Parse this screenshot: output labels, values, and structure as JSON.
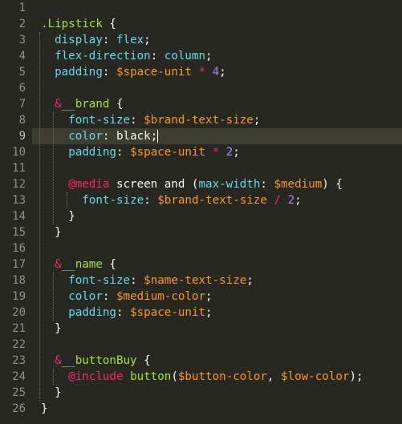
{
  "editor": {
    "theme_colors": {
      "background": "#272822",
      "line_highlight": "#3e3d32",
      "gutter_text": "#8f908a",
      "selector": "#a6e22e",
      "property": "#66d9ef",
      "variable": "#fd971f",
      "number": "#ae81ff",
      "at_rule": "#f92672",
      "text": "#f8f8f2"
    },
    "active_line": 9,
    "lines": [
      {
        "num": "1",
        "indent": 0,
        "tokens": []
      },
      {
        "num": "2",
        "indent": 0,
        "tokens": [
          {
            "t": "sel",
            "v": ".Lipstick"
          },
          {
            "t": "plain",
            "v": " {"
          }
        ]
      },
      {
        "num": "3",
        "indent": 1,
        "tokens": [
          {
            "t": "prop",
            "v": "display"
          },
          {
            "t": "plain",
            "v": ": "
          },
          {
            "t": "prop",
            "v": "flex"
          },
          {
            "t": "plain",
            "v": ";"
          }
        ]
      },
      {
        "num": "4",
        "indent": 1,
        "tokens": [
          {
            "t": "prop",
            "v": "flex-direction"
          },
          {
            "t": "plain",
            "v": ": "
          },
          {
            "t": "prop",
            "v": "column"
          },
          {
            "t": "plain",
            "v": ";"
          }
        ]
      },
      {
        "num": "5",
        "indent": 1,
        "tokens": [
          {
            "t": "prop",
            "v": "padding"
          },
          {
            "t": "plain",
            "v": ": "
          },
          {
            "t": "var",
            "v": "$space-unit"
          },
          {
            "t": "plain",
            "v": " "
          },
          {
            "t": "at",
            "v": "*"
          },
          {
            "t": "plain",
            "v": " "
          },
          {
            "t": "num",
            "v": "4"
          },
          {
            "t": "plain",
            "v": ";"
          }
        ]
      },
      {
        "num": "6",
        "indent": 0,
        "tokens": []
      },
      {
        "num": "7",
        "indent": 1,
        "tokens": [
          {
            "t": "at",
            "v": "&"
          },
          {
            "t": "sel",
            "v": "__brand"
          },
          {
            "t": "plain",
            "v": " {"
          }
        ]
      },
      {
        "num": "8",
        "indent": 2,
        "tokens": [
          {
            "t": "prop",
            "v": "font-size"
          },
          {
            "t": "plain",
            "v": ": "
          },
          {
            "t": "var",
            "v": "$brand-text-size"
          },
          {
            "t": "plain",
            "v": ";"
          }
        ]
      },
      {
        "num": "9",
        "indent": 2,
        "tokens": [
          {
            "t": "prop",
            "v": "color"
          },
          {
            "t": "plain",
            "v": ": "
          },
          {
            "t": "plain",
            "v": "black"
          },
          {
            "t": "plain",
            "v": ";"
          },
          {
            "t": "cursor",
            "v": ""
          }
        ]
      },
      {
        "num": "10",
        "indent": 2,
        "tokens": [
          {
            "t": "prop",
            "v": "padding"
          },
          {
            "t": "plain",
            "v": ": "
          },
          {
            "t": "var",
            "v": "$space-unit"
          },
          {
            "t": "plain",
            "v": " "
          },
          {
            "t": "at",
            "v": "*"
          },
          {
            "t": "plain",
            "v": " "
          },
          {
            "t": "num",
            "v": "2"
          },
          {
            "t": "plain",
            "v": ";"
          }
        ]
      },
      {
        "num": "11",
        "indent": 0,
        "tokens": []
      },
      {
        "num": "12",
        "indent": 2,
        "tokens": [
          {
            "t": "at",
            "v": "@media"
          },
          {
            "t": "plain",
            "v": " screen and ("
          },
          {
            "t": "prop",
            "v": "max-width"
          },
          {
            "t": "plain",
            "v": ": "
          },
          {
            "t": "var",
            "v": "$medium"
          },
          {
            "t": "plain",
            "v": ") {"
          }
        ]
      },
      {
        "num": "13",
        "indent": 3,
        "tokens": [
          {
            "t": "prop",
            "v": "font-size"
          },
          {
            "t": "plain",
            "v": ": "
          },
          {
            "t": "var",
            "v": "$brand-text-size"
          },
          {
            "t": "plain",
            "v": " "
          },
          {
            "t": "at",
            "v": "/"
          },
          {
            "t": "plain",
            "v": " "
          },
          {
            "t": "num",
            "v": "2"
          },
          {
            "t": "plain",
            "v": ";"
          }
        ]
      },
      {
        "num": "14",
        "indent": 2,
        "tokens": [
          {
            "t": "plain",
            "v": "}"
          }
        ]
      },
      {
        "num": "15",
        "indent": 1,
        "tokens": [
          {
            "t": "plain",
            "v": "}"
          }
        ]
      },
      {
        "num": "16",
        "indent": 0,
        "tokens": []
      },
      {
        "num": "17",
        "indent": 1,
        "tokens": [
          {
            "t": "at",
            "v": "&"
          },
          {
            "t": "sel",
            "v": "__name"
          },
          {
            "t": "plain",
            "v": " {"
          }
        ]
      },
      {
        "num": "18",
        "indent": 2,
        "tokens": [
          {
            "t": "prop",
            "v": "font-size"
          },
          {
            "t": "plain",
            "v": ": "
          },
          {
            "t": "var",
            "v": "$name-text-size"
          },
          {
            "t": "plain",
            "v": ";"
          }
        ]
      },
      {
        "num": "19",
        "indent": 2,
        "tokens": [
          {
            "t": "prop",
            "v": "color"
          },
          {
            "t": "plain",
            "v": ": "
          },
          {
            "t": "var",
            "v": "$medium-color"
          },
          {
            "t": "plain",
            "v": ";"
          }
        ]
      },
      {
        "num": "20",
        "indent": 2,
        "tokens": [
          {
            "t": "prop",
            "v": "padding"
          },
          {
            "t": "plain",
            "v": ": "
          },
          {
            "t": "var",
            "v": "$space-unit"
          },
          {
            "t": "plain",
            "v": ";"
          }
        ]
      },
      {
        "num": "21",
        "indent": 1,
        "tokens": [
          {
            "t": "plain",
            "v": "}"
          }
        ]
      },
      {
        "num": "22",
        "indent": 0,
        "tokens": []
      },
      {
        "num": "23",
        "indent": 1,
        "tokens": [
          {
            "t": "at",
            "v": "&"
          },
          {
            "t": "sel",
            "v": "__buttonBuy"
          },
          {
            "t": "plain",
            "v": " {"
          }
        ]
      },
      {
        "num": "24",
        "indent": 2,
        "tokens": [
          {
            "t": "at",
            "v": "@include"
          },
          {
            "t": "plain",
            "v": " "
          },
          {
            "t": "sel",
            "v": "button"
          },
          {
            "t": "plain",
            "v": "("
          },
          {
            "t": "var",
            "v": "$button-color"
          },
          {
            "t": "plain",
            "v": ", "
          },
          {
            "t": "var",
            "v": "$low-color"
          },
          {
            "t": "plain",
            "v": ");"
          }
        ]
      },
      {
        "num": "25",
        "indent": 1,
        "tokens": [
          {
            "t": "plain",
            "v": "}"
          }
        ]
      },
      {
        "num": "26",
        "indent": 0,
        "tokens": [
          {
            "t": "plain",
            "v": "}"
          }
        ]
      }
    ]
  }
}
